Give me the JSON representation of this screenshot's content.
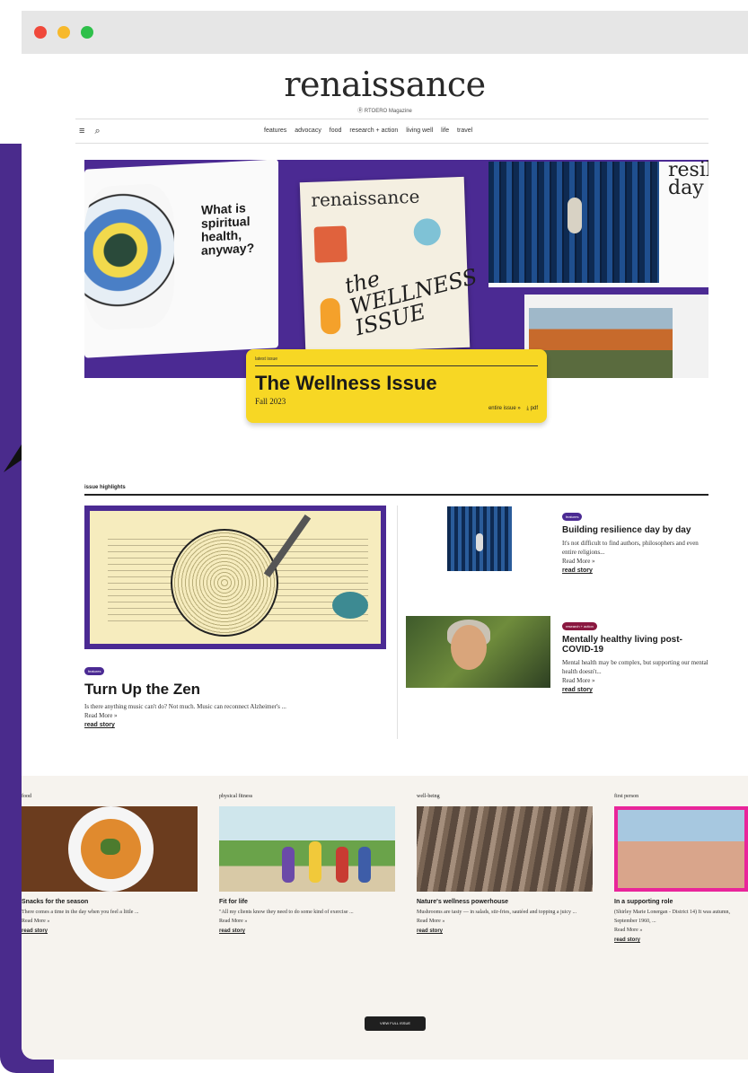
{
  "window": {
    "controls": [
      "close",
      "minimize",
      "zoom"
    ]
  },
  "site": {
    "logo": "renaissance",
    "tagline": "Ⓡ RTOERO Magazine"
  },
  "navbar": {
    "menu_icon": "≡",
    "search_icon": "⌕",
    "links": [
      "features",
      "advocacy",
      "food",
      "research + action",
      "living well",
      "life",
      "travel"
    ]
  },
  "hero": {
    "spread_left_text": "What is spiritual health, anyway?",
    "cover_title": "renaissance",
    "cover_headline": "the WELLNESS ISSUE",
    "spread_right_text": "resilience day by"
  },
  "issue_card": {
    "label": "latest issue",
    "title": "The Wellness Issue",
    "date": "Fall 2023",
    "link_issue": "entire issue »",
    "link_pdf": "⤓ pdf"
  },
  "highlights": {
    "header": "issue highlights",
    "feature": {
      "tag": "features",
      "title": "Turn Up the Zen",
      "excerpt": "Is there anything music can't do? Not much. Music can reconnect Alzheimer's ...",
      "read_more": "Read More »",
      "read_story": "read story"
    },
    "side": [
      {
        "tag": "features",
        "title": "Building resilience day by day",
        "excerpt": "It's not difficult to find authors, philosophers and even entire religions...",
        "read_more": "Read More »",
        "read_story": "read story"
      },
      {
        "tag": "research + action",
        "title": "Mentally healthy living post-COVID-19",
        "excerpt": "Mental health may be complex, but supporting our mental health doesn't...",
        "read_more": "Read More »",
        "read_story": "read story"
      }
    ]
  },
  "categories": [
    {
      "label": "food",
      "title": "Snacks for the season",
      "excerpt": "There comes a time in the day when you feel a little ...",
      "read_more": "Read More »",
      "read_story": "read story"
    },
    {
      "label": "physical fitness",
      "title": "Fit for life",
      "excerpt": "\"All my clients know they need to do some kind of exercise ...",
      "read_more": "Read More »",
      "read_story": "read story"
    },
    {
      "label": "well-being",
      "title": "Nature's wellness powerhouse",
      "excerpt": "Mushrooms are tasty — in salads, stir-fries, sautéed and topping a juicy ...",
      "read_more": "Read More »",
      "read_story": "read story"
    },
    {
      "label": "first person",
      "title": "In a supporting role",
      "excerpt": "(Shirley Marie Lonergan - District 14) It was autumn, September 1960, ...",
      "read_more": "Read More »",
      "read_story": "read story"
    }
  ],
  "view_full_issue": "VIEW FULL ISSUE",
  "colors": {
    "brand_purple": "#4b2a93",
    "issue_yellow": "#f7d724",
    "tag_maroon": "#8a1840",
    "first_person_pink": "#e9259a"
  }
}
